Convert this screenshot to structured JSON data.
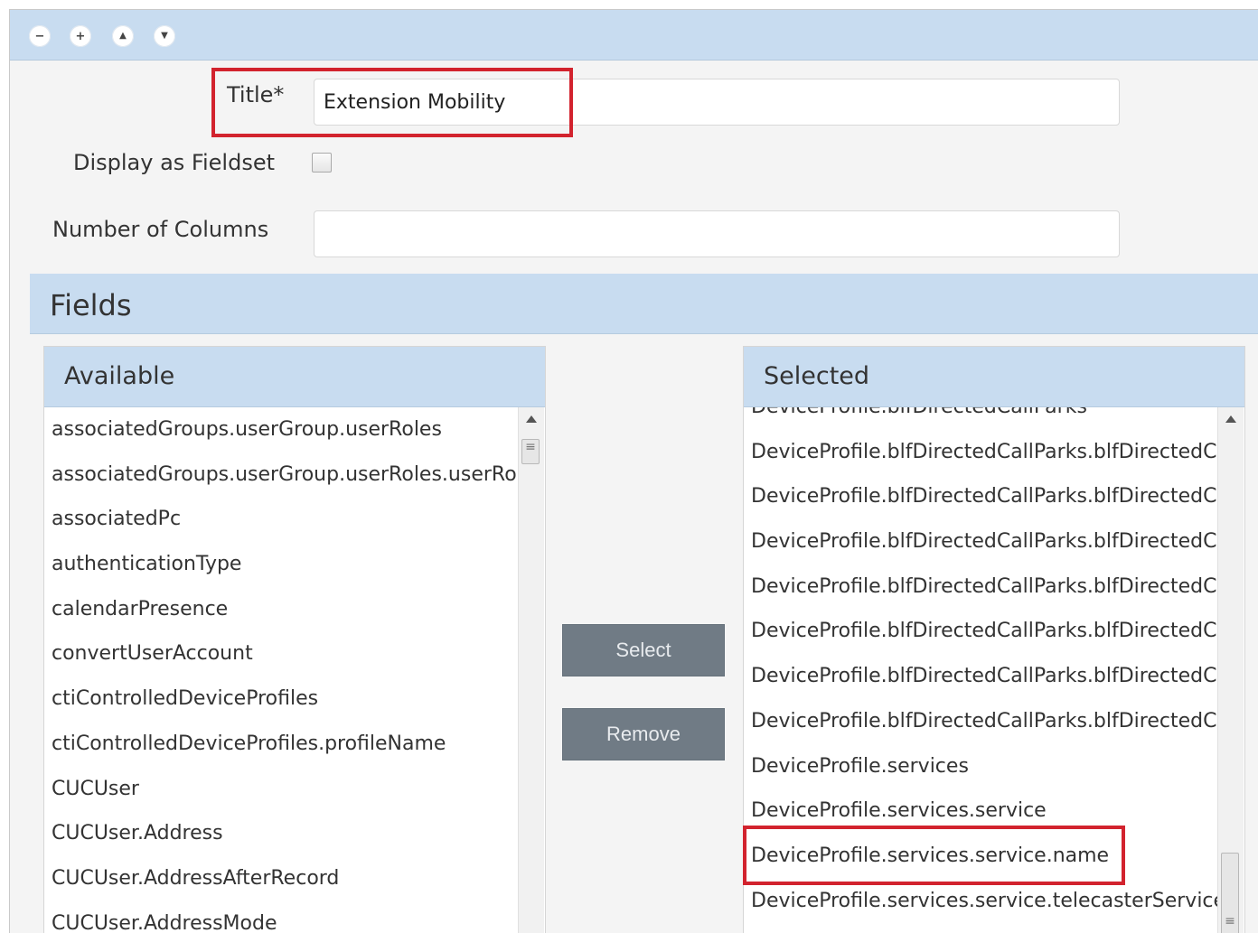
{
  "toolbar": {
    "icons": [
      "minus-icon",
      "plus-icon",
      "arrow-up-icon",
      "arrow-down-icon"
    ],
    "glyphs": [
      "−",
      "+",
      "▲",
      "▼"
    ]
  },
  "form": {
    "title_label": "Title*",
    "title_value": "Extension Mobility",
    "fieldset_label": "Display as Fieldset",
    "fieldset_checked": false,
    "columns_label": "Number of Columns",
    "columns_value": ""
  },
  "fields": {
    "heading": "Fields",
    "available": {
      "heading": "Available",
      "items": [
        "associatedGroups.userGroup.userRoles",
        "associatedGroups.userGroup.userRoles.userRo",
        "associatedPc",
        "authenticationType",
        "calendarPresence",
        "convertUserAccount",
        "ctiControlledDeviceProfiles",
        "ctiControlledDeviceProfiles.profileName",
        "CUCUser",
        "CUCUser.Address",
        "CUCUser.AddressAfterRecord",
        "CUCUser.AddressMode"
      ]
    },
    "buttons": {
      "select": "Select",
      "remove": "Remove"
    },
    "selected": {
      "heading": "Selected",
      "items": [
        "DeviceProfile.blfDirectedCallParks",
        "DeviceProfile.blfDirectedCallParks.blfDirectedCa",
        "DeviceProfile.blfDirectedCallParks.blfDirectedCa",
        "DeviceProfile.blfDirectedCallParks.blfDirectedCa",
        "DeviceProfile.blfDirectedCallParks.blfDirectedCa",
        "DeviceProfile.blfDirectedCallParks.blfDirectedCa",
        "DeviceProfile.blfDirectedCallParks.blfDirectedCa",
        "DeviceProfile.blfDirectedCallParks.blfDirectedCa",
        "DeviceProfile.services",
        "DeviceProfile.services.service",
        "DeviceProfile.services.service.name",
        "DeviceProfile.services.service.telecasterServiceN"
      ],
      "highlighted_index": 10
    }
  },
  "colors": {
    "header_blue": "#c8dcf0",
    "highlight_red": "#d2232e",
    "button_gray": "#707b85"
  }
}
